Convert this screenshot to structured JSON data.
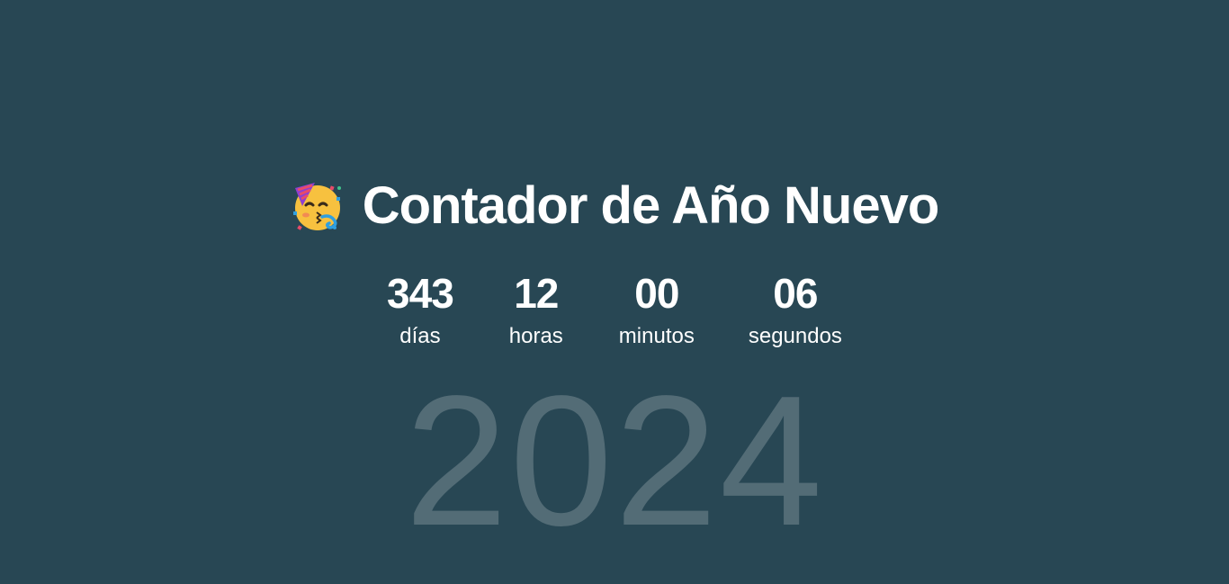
{
  "header": {
    "icon": "partying-face-icon",
    "title": "Contador de Año Nuevo"
  },
  "countdown": {
    "days": {
      "value": "343",
      "label": "días"
    },
    "hours": {
      "value": "12",
      "label": "horas"
    },
    "minutes": {
      "value": "00",
      "label": "minutos"
    },
    "seconds": {
      "value": "06",
      "label": "segundos"
    }
  },
  "year": "2024",
  "colors": {
    "background": "#284754",
    "text": "#ffffff",
    "year_text": "rgba(255,255,255,0.2)"
  }
}
